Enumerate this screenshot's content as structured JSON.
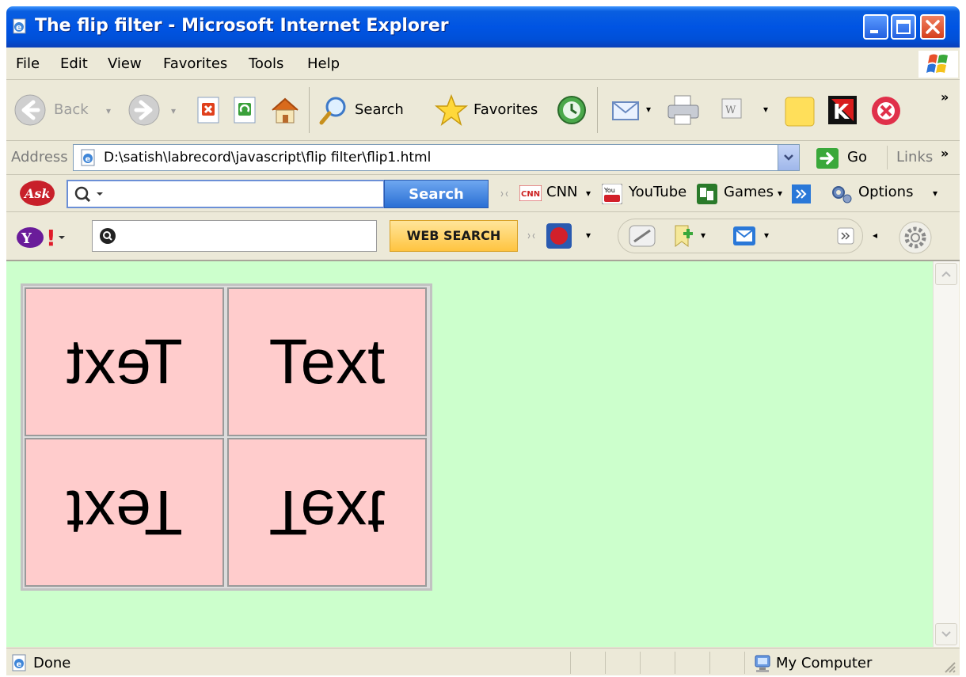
{
  "window": {
    "title": "The flip filter - Microsoft Internet Explorer"
  },
  "menu": {
    "items": [
      "File",
      "Edit",
      "View",
      "Favorites",
      "Tools",
      "Help"
    ]
  },
  "toolbar": {
    "back_label": "Back",
    "search_label": "Search",
    "favorites_label": "Favorites",
    "more_chevron": "»"
  },
  "address": {
    "label": "Address",
    "url": "D:\\satish\\labrecord\\javascript\\flip filter\\flip1.html",
    "go_label": "Go",
    "links_label": "Links"
  },
  "ask_toolbar": {
    "search_button": "Search",
    "cnn_label": "CNN",
    "youtube_label": "YouTube",
    "games_label": "Games",
    "options_label": "Options"
  },
  "yahoo_toolbar": {
    "web_search_button": "WEB SEARCH"
  },
  "content": {
    "background": "#ccffcc",
    "cell_background": "#ffcccc",
    "cells": [
      {
        "text": "Text",
        "flip": "horizontal"
      },
      {
        "text": "Text",
        "flip": "none"
      },
      {
        "text": "Text",
        "flip": "both"
      },
      {
        "text": "Text",
        "flip": "vertical"
      }
    ]
  },
  "status": {
    "text": "Done",
    "zone": "My Computer"
  }
}
